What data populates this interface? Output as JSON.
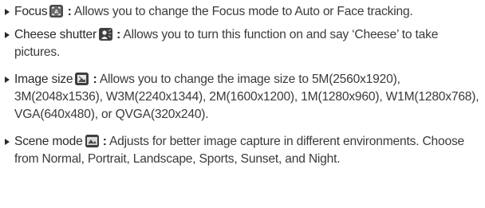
{
  "items": [
    {
      "term": "Focus",
      "icon": "focus-icon",
      "separator": ":",
      "description": "Allows you to change the Focus mode to Auto or Face tracking."
    },
    {
      "term": "Cheese shutter",
      "icon": "cheese-shutter-icon",
      "separator": ":",
      "description": "Allows you to turn this function on and say ‘Cheese’ to take pictures."
    },
    {
      "term": "Image size",
      "icon": "image-size-icon",
      "separator": ":",
      "description": "Allows you to change the image size to 5M(2560x1920), 3M(2048x1536), W3M(2240x1344), 2M(1600x1200), 1M(1280x960), W1M(1280x768), VGA(640x480), or QVGA(320x240)."
    },
    {
      "term": "Scene mode",
      "icon": "scene-mode-icon",
      "separator": ":",
      "description": "Adjusts for better image capture in different environments. Choose from Normal, Portrait, Landscape, Sports, Sunset, and Night."
    }
  ]
}
